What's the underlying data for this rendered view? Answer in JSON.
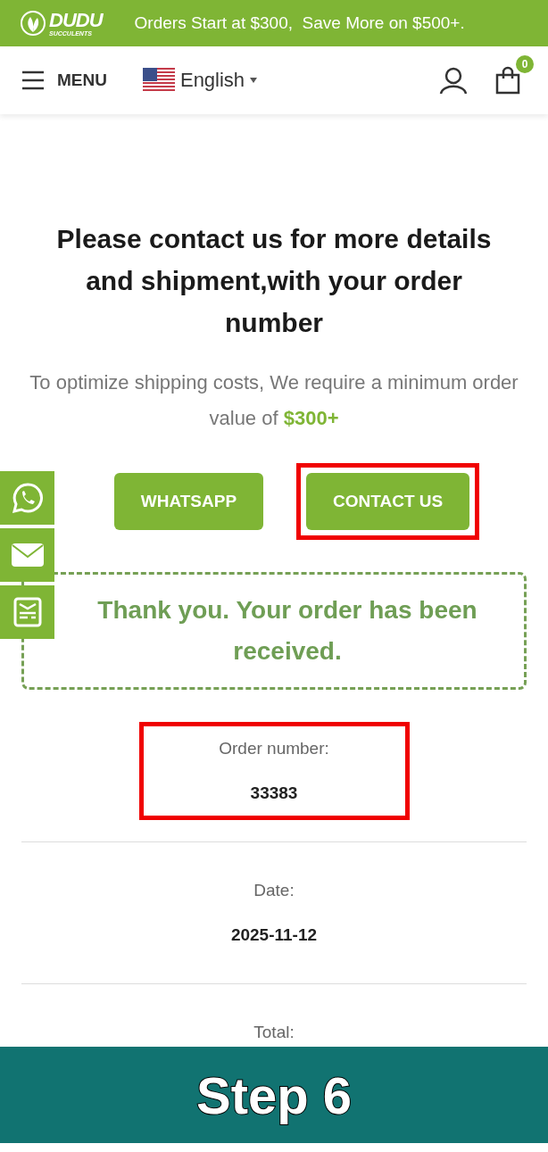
{
  "top_bar": {
    "logo": {
      "name": "DUDU",
      "tagline": "SUCCULENTS"
    },
    "promo": "Orders Start at $300,  Save More on $500+."
  },
  "header": {
    "menu_label": "MENU",
    "language": "English",
    "cart_count": "0"
  },
  "heading": "Please contact us for more details and shipment,with your order number",
  "note": "To optimize shipping costs, We require a minimum order value of **$300+**",
  "buttons": [
    {
      "label": "WHATSAPP",
      "highlighted": false
    },
    {
      "label": "CONTACT US",
      "highlighted": true
    }
  ],
  "side_widget": [
    {
      "kind": "whatsapp"
    },
    {
      "kind": "mail"
    },
    {
      "kind": "form"
    }
  ],
  "thank_you": "Thank you. Your order has been received.",
  "details": [
    {
      "label": "Order number:",
      "value": "33383",
      "highlighted": true
    },
    {
      "label": "Date:",
      "value": "2025-11-12",
      "highlighted": false
    },
    {
      "label": "Total:",
      "highlighted": false
    }
  ],
  "banner": "Step 6"
}
